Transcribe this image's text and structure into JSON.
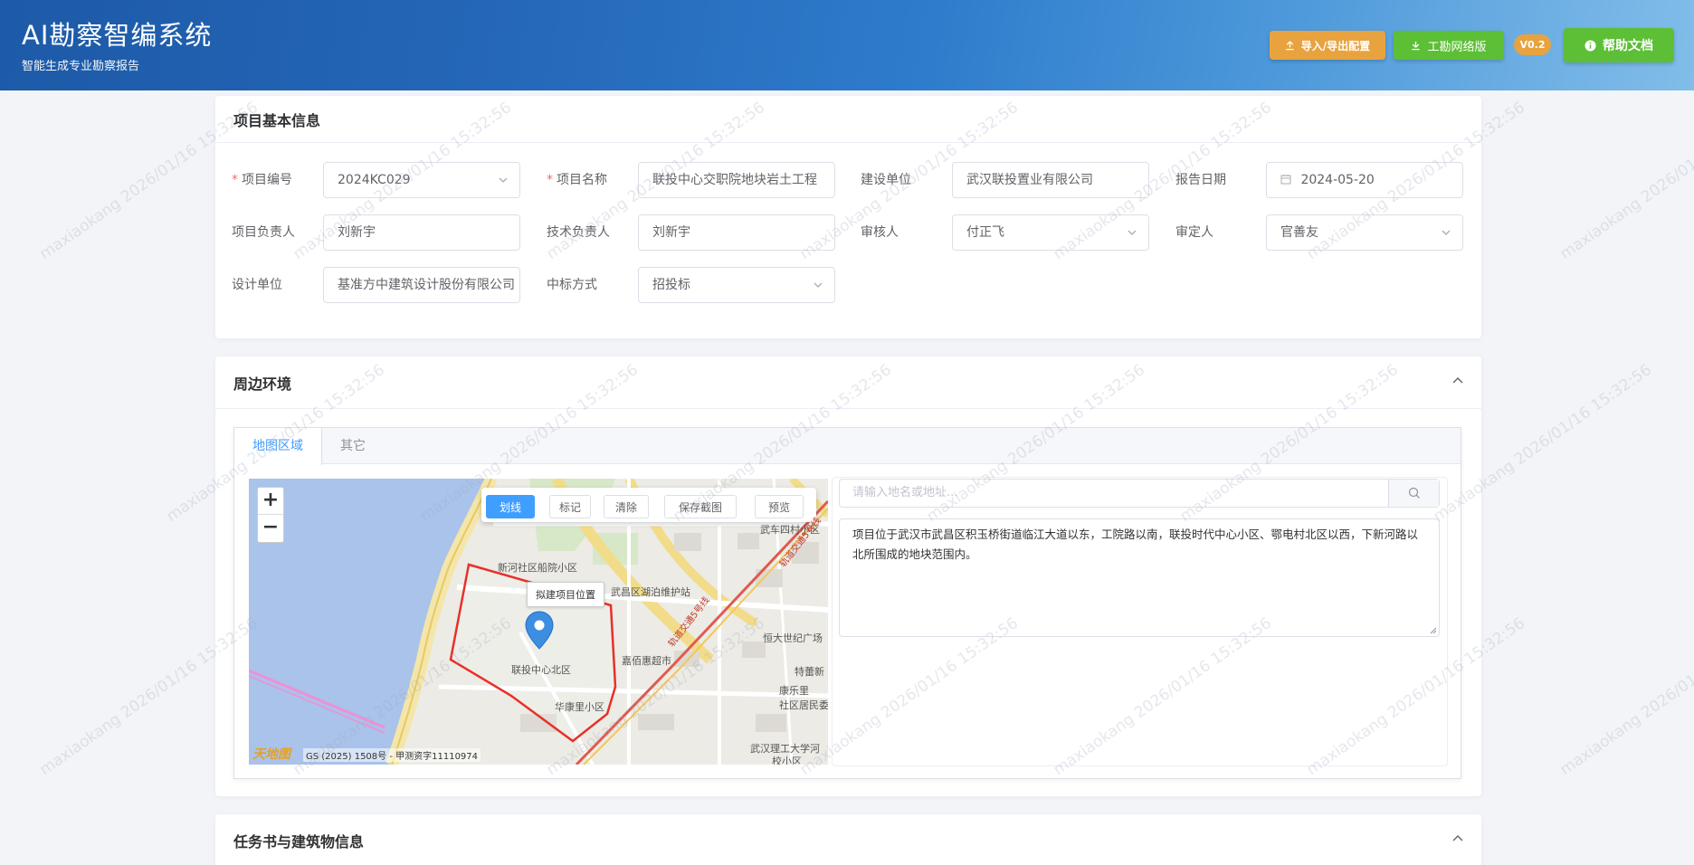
{
  "header": {
    "title": "AI勘察智编系统",
    "subtitle": "智能生成专业勘察报告",
    "import_export_label": "导入/导出配置",
    "network_label": "工勘网络版",
    "version": "V0.2",
    "help_label": "帮助文档"
  },
  "project_info": {
    "title": "项目基本信息",
    "fields": {
      "project_no": {
        "label": "项目编号",
        "value": "2024KC029"
      },
      "project_name": {
        "label": "项目名称",
        "value": "联投中心交职院地块岩土工程"
      },
      "construction_unit": {
        "label": "建设单位",
        "value": "武汉联投置业有限公司"
      },
      "report_date": {
        "label": "报告日期",
        "value": "2024-05-20"
      },
      "project_leader": {
        "label": "项目负责人",
        "value": "刘新宇"
      },
      "tech_leader": {
        "label": "技术负责人",
        "value": "刘新宇"
      },
      "reviewer": {
        "label": "审核人",
        "value": "付正飞"
      },
      "approver": {
        "label": "审定人",
        "value": "官善友"
      },
      "design_unit": {
        "label": "设计单位",
        "value": "基准方中建筑设计股份有限公司"
      },
      "bid_method": {
        "label": "中标方式",
        "value": "招投标"
      }
    }
  },
  "environment": {
    "title": "周边环境",
    "tabs": [
      "地图区域",
      "其它"
    ],
    "map": {
      "tools": [
        "划线",
        "标记",
        "清除",
        "保存截图",
        "预览"
      ],
      "zoom_in": "+",
      "zoom_out": "−",
      "popup": "拟建项目位置",
      "labels": {
        "wuche": "武车四村小区",
        "xinhe": "新河社区船院小区",
        "lake": "武昌区湖泊维护站",
        "rail1": "轨道交通5号线",
        "rail2": "轨道交通5号线",
        "hengda": "恒大世纪广场",
        "north": "联投中心北区",
        "jiabai": "嘉佰惠超市",
        "tese": "特蕾新",
        "kangle": "康乐里",
        "community": "社区居民委",
        "huakang": "华康里小区",
        "whut": "武汉理工大学河",
        "campus": "校小区",
        "copyright": "GS (2025) 1508号 - 甲测资字11110974",
        "logo": "天地图"
      }
    },
    "search_placeholder": "请输入地名或地址...",
    "description": "项目位于武汉市武昌区积玉桥街道临江大道以东，工院路以南，联投时代中心小区、鄂电村北区以西，下新河路以北所围成的地块范围内。"
  },
  "task_section": {
    "title": "任务书与建筑物信息"
  },
  "watermark": "maxiaokang 2026/01/16 15:32:56",
  "colors": {
    "primary": "#409eff",
    "orange": "#e8a33e",
    "green": "#5cbf36",
    "required": "#f56c6c"
  }
}
